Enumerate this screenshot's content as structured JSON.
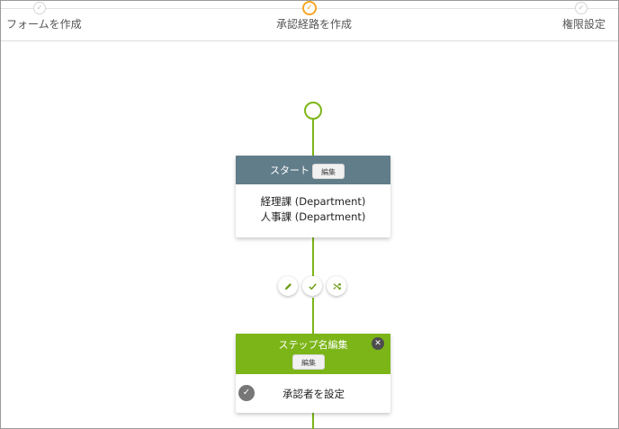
{
  "stepper": {
    "steps": [
      {
        "label": "フォームを作成",
        "icon": "check-icon",
        "state": "done"
      },
      {
        "label": "承認経路を作成",
        "icon": "check-icon",
        "state": "active"
      },
      {
        "label": "権限設定",
        "icon": "check-icon",
        "state": "pending"
      }
    ],
    "accent_color": "#f5a623"
  },
  "flow": {
    "line_color": "#7cb518",
    "start_node": {
      "title": "スタート",
      "edit_label": "編集",
      "departments": [
        "経理課 (Department)",
        "人事課 (Department)"
      ]
    },
    "actions": [
      {
        "icon": "pencil-icon"
      },
      {
        "icon": "check-icon"
      },
      {
        "icon": "shuffle-icon"
      }
    ],
    "step_node": {
      "title": "ステップ名編集",
      "edit_label": "編集",
      "approver_label": "承認者を設定"
    }
  }
}
